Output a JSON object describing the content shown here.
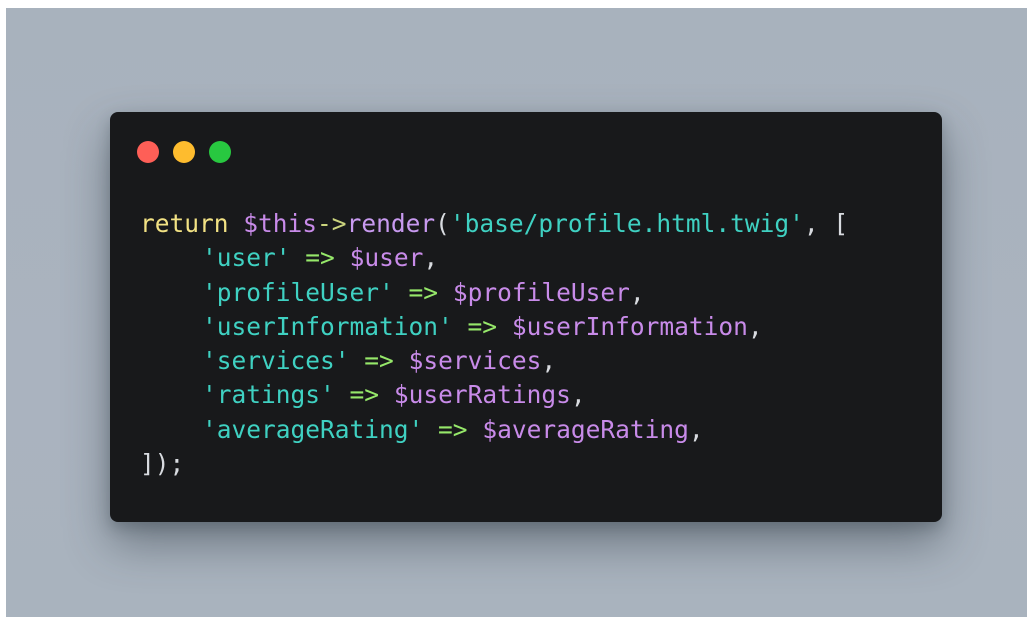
{
  "window_controls": {
    "close_color": "#fe5f57",
    "minimize_color": "#febc2e",
    "maximize_color": "#28c840"
  },
  "code": {
    "line1": {
      "keyword": "return",
      "variable": "$this",
      "operator": "->",
      "method": "render",
      "open_paren": "(",
      "template": "'base/profile.html.twig'",
      "after_template": ", ["
    },
    "entries": [
      {
        "key": "'user'",
        "arrow": "=>",
        "value": "$user",
        "comma": ","
      },
      {
        "key": "'profileUser'",
        "arrow": "=>",
        "value": "$profileUser",
        "comma": ","
      },
      {
        "key": "'userInformation'",
        "arrow": "=>",
        "value": "$userInformation",
        "comma": ","
      },
      {
        "key": "'services'",
        "arrow": "=>",
        "value": "$services",
        "comma": ","
      },
      {
        "key": "'ratings'",
        "arrow": "=>",
        "value": "$userRatings",
        "comma": ","
      },
      {
        "key": "'averageRating'",
        "arrow": "=>",
        "value": "$averageRating",
        "comma": ","
      }
    ],
    "closing": "]);"
  }
}
